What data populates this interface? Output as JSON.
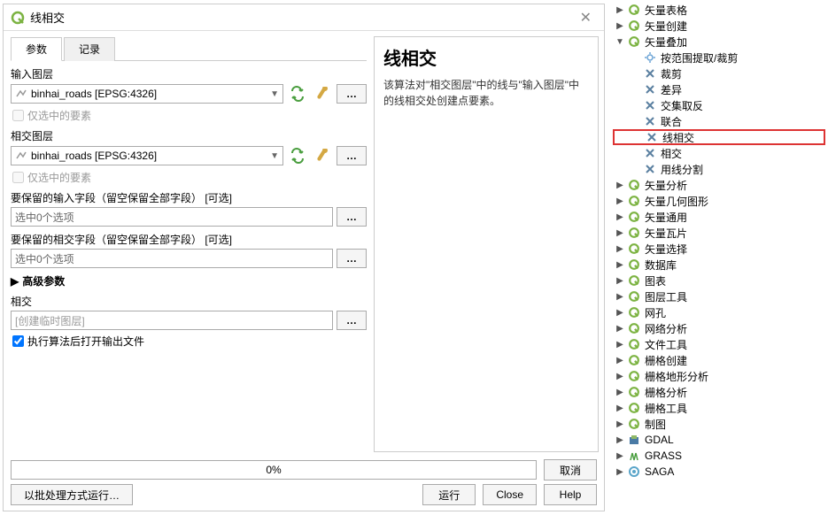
{
  "dialog": {
    "title": "线相交",
    "close": "✕",
    "tabs": {
      "params": "参数",
      "log": "记录"
    },
    "input_layer_label": "输入图层",
    "input_layer_value": "binhai_roads [EPSG:4326]",
    "selected_only1": "仅选中的要素",
    "intersect_layer_label": "相交图层",
    "intersect_layer_value": "binhai_roads [EPSG:4326]",
    "selected_only2": "仅选中的要素",
    "keep_input_fields_label": "要保留的输入字段（留空保留全部字段） [可选]",
    "keep_input_fields_value": "选中0个选项",
    "keep_intersect_fields_label": "要保留的相交字段（留空保留全部字段） [可选]",
    "keep_intersect_fields_value": "选中0个选项",
    "advanced": "高级参数",
    "output_label": "相交",
    "output_placeholder": "[创建临时图层]",
    "open_after": "执行算法后打开输出文件",
    "progress": "0%",
    "buttons": {
      "cancel": "取消",
      "batch": "以批处理方式运行…",
      "run": "运行",
      "close": "Close",
      "help": "Help"
    },
    "dots": "…"
  },
  "help": {
    "title": "线相交",
    "desc": "该算法对\"相交图层\"中的线与\"输入图层\"中的线相交处创建点要素。"
  },
  "tree": {
    "items": [
      {
        "indent": 0,
        "arrow": "▶",
        "icon": "q",
        "label": "矢量表格"
      },
      {
        "indent": 0,
        "arrow": "▶",
        "icon": "q",
        "label": "矢量创建"
      },
      {
        "indent": 0,
        "arrow": "▼",
        "icon": "q",
        "label": "矢量叠加"
      },
      {
        "indent": 1,
        "arrow": "",
        "icon": "gear",
        "label": "按范围提取/裁剪"
      },
      {
        "indent": 1,
        "arrow": "",
        "icon": "cross",
        "label": "裁剪"
      },
      {
        "indent": 1,
        "arrow": "",
        "icon": "cross",
        "label": "差异"
      },
      {
        "indent": 1,
        "arrow": "",
        "icon": "cross",
        "label": "交集取反"
      },
      {
        "indent": 1,
        "arrow": "",
        "icon": "cross",
        "label": "联合"
      },
      {
        "indent": 1,
        "arrow": "",
        "icon": "cross",
        "label": "线相交",
        "hl": true
      },
      {
        "indent": 1,
        "arrow": "",
        "icon": "cross",
        "label": "相交"
      },
      {
        "indent": 1,
        "arrow": "",
        "icon": "cross",
        "label": "用线分割"
      },
      {
        "indent": 0,
        "arrow": "▶",
        "icon": "q",
        "label": "矢量分析"
      },
      {
        "indent": 0,
        "arrow": "▶",
        "icon": "q",
        "label": "矢量几何图形"
      },
      {
        "indent": 0,
        "arrow": "▶",
        "icon": "q",
        "label": "矢量通用"
      },
      {
        "indent": 0,
        "arrow": "▶",
        "icon": "q",
        "label": "矢量瓦片"
      },
      {
        "indent": 0,
        "arrow": "▶",
        "icon": "q",
        "label": "矢量选择"
      },
      {
        "indent": 0,
        "arrow": "▶",
        "icon": "q",
        "label": "数据库"
      },
      {
        "indent": 0,
        "arrow": "▶",
        "icon": "q",
        "label": "图表"
      },
      {
        "indent": 0,
        "arrow": "▶",
        "icon": "q",
        "label": "图层工具"
      },
      {
        "indent": 0,
        "arrow": "▶",
        "icon": "q",
        "label": "网孔"
      },
      {
        "indent": 0,
        "arrow": "▶",
        "icon": "q",
        "label": "网络分析"
      },
      {
        "indent": 0,
        "arrow": "▶",
        "icon": "q",
        "label": "文件工具"
      },
      {
        "indent": 0,
        "arrow": "▶",
        "icon": "q",
        "label": "栅格创建"
      },
      {
        "indent": 0,
        "arrow": "▶",
        "icon": "q",
        "label": "栅格地形分析"
      },
      {
        "indent": 0,
        "arrow": "▶",
        "icon": "q",
        "label": "栅格分析"
      },
      {
        "indent": 0,
        "arrow": "▶",
        "icon": "q",
        "label": "栅格工具"
      },
      {
        "indent": 0,
        "arrow": "▶",
        "icon": "q",
        "label": "制图"
      },
      {
        "indent": 0,
        "arrow": "▶",
        "icon": "gdal",
        "label": "GDAL"
      },
      {
        "indent": 0,
        "arrow": "▶",
        "icon": "grass",
        "label": "GRASS"
      },
      {
        "indent": 0,
        "arrow": "▶",
        "icon": "saga",
        "label": "SAGA"
      }
    ]
  }
}
